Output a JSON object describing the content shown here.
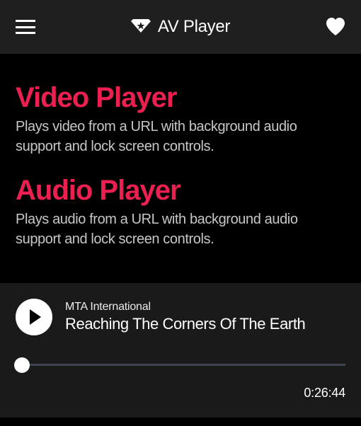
{
  "header": {
    "title": "AV Player"
  },
  "sections": {
    "video": {
      "title": "Video Player",
      "desc": "Plays video from a URL with background audio support and lock screen controls."
    },
    "audio": {
      "title": "Audio Player",
      "desc": "Plays audio from a URL with background audio support and lock screen controls."
    }
  },
  "player": {
    "artist": "MTA International",
    "title": "Reaching The Corners Of The Earth",
    "duration": "0:26:44"
  }
}
